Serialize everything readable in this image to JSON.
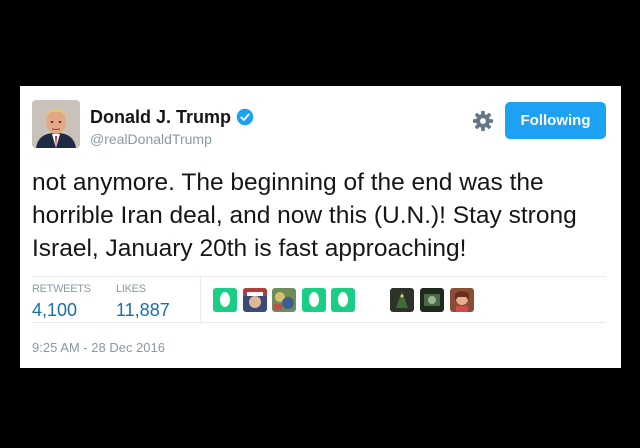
{
  "tweet": {
    "author_name": "Donald J. Trump",
    "handle": "@realDonaldTrump",
    "follow_label": "Following",
    "text": "not anymore. The beginning of the end was the horrible Iran deal, and now this (U.N.)! Stay strong Israel, January 20th is fast approaching!",
    "retweets_label": "RETWEETS",
    "retweets_count": "4,100",
    "likes_label": "LIKES",
    "likes_count": "11,887",
    "timestamp": "9:25 AM - 28 Dec 2016"
  },
  "likers": [
    {
      "type": "default-egg"
    },
    {
      "type": "photo"
    },
    {
      "type": "photo"
    },
    {
      "type": "default-egg"
    },
    {
      "type": "default-egg"
    },
    {
      "type": "photo"
    },
    {
      "type": "photo"
    },
    {
      "type": "photo"
    }
  ],
  "colors": {
    "accent": "#1da1f2",
    "verified": "#1da1f2",
    "stat_value": "#1b6ea8",
    "muted": "#8899a6",
    "egg": "#19cf86"
  },
  "icons": [
    "verified-badge-icon",
    "gear-icon"
  ]
}
